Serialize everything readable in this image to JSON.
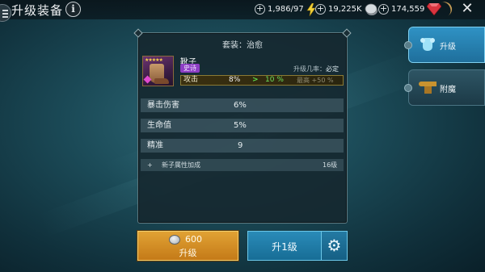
{
  "header": {
    "title": "升级装备",
    "info_label": "i",
    "close_label": "✕"
  },
  "resources": [
    {
      "name": "energy",
      "value": "1,986/97",
      "icon": "lightning-icon",
      "color": "#f2d23a"
    },
    {
      "name": "silver",
      "value": "19,225K",
      "icon": "silver-coin-icon",
      "color": "#c9cfd4"
    },
    {
      "name": "gems",
      "value": "174,559",
      "icon": "ruby-icon",
      "color": "#d9343f"
    }
  ],
  "panel": {
    "set_title": "套装：治愈",
    "item": {
      "name": "靴子",
      "rarity": "史诗",
      "rarity_color": "#8e3fc5",
      "stars": "★★★★★",
      "rate_label": "升级几率：",
      "rate_value": "必定",
      "primary": {
        "label": "攻击",
        "current": "8%",
        "arrow": ">",
        "next": "10 %",
        "max": "最高 +50 %"
      }
    },
    "stats": [
      {
        "label": "暴击伤害",
        "value": "6%"
      },
      {
        "label": "生命值",
        "value": "5%"
      },
      {
        "label": "精准",
        "value": "9"
      }
    ],
    "subset": {
      "plus": "+",
      "label": "新子属性加成",
      "level": "16级"
    }
  },
  "actions": {
    "upgrade_cost": "600",
    "upgrade_label": "升级",
    "level_up_label": "升1级",
    "gear_icon": "⚙"
  },
  "tabs": [
    {
      "label": "升级",
      "icon": "armor-icon",
      "active": true
    },
    {
      "label": "附魔",
      "icon": "anvil-icon",
      "active": false
    }
  ]
}
